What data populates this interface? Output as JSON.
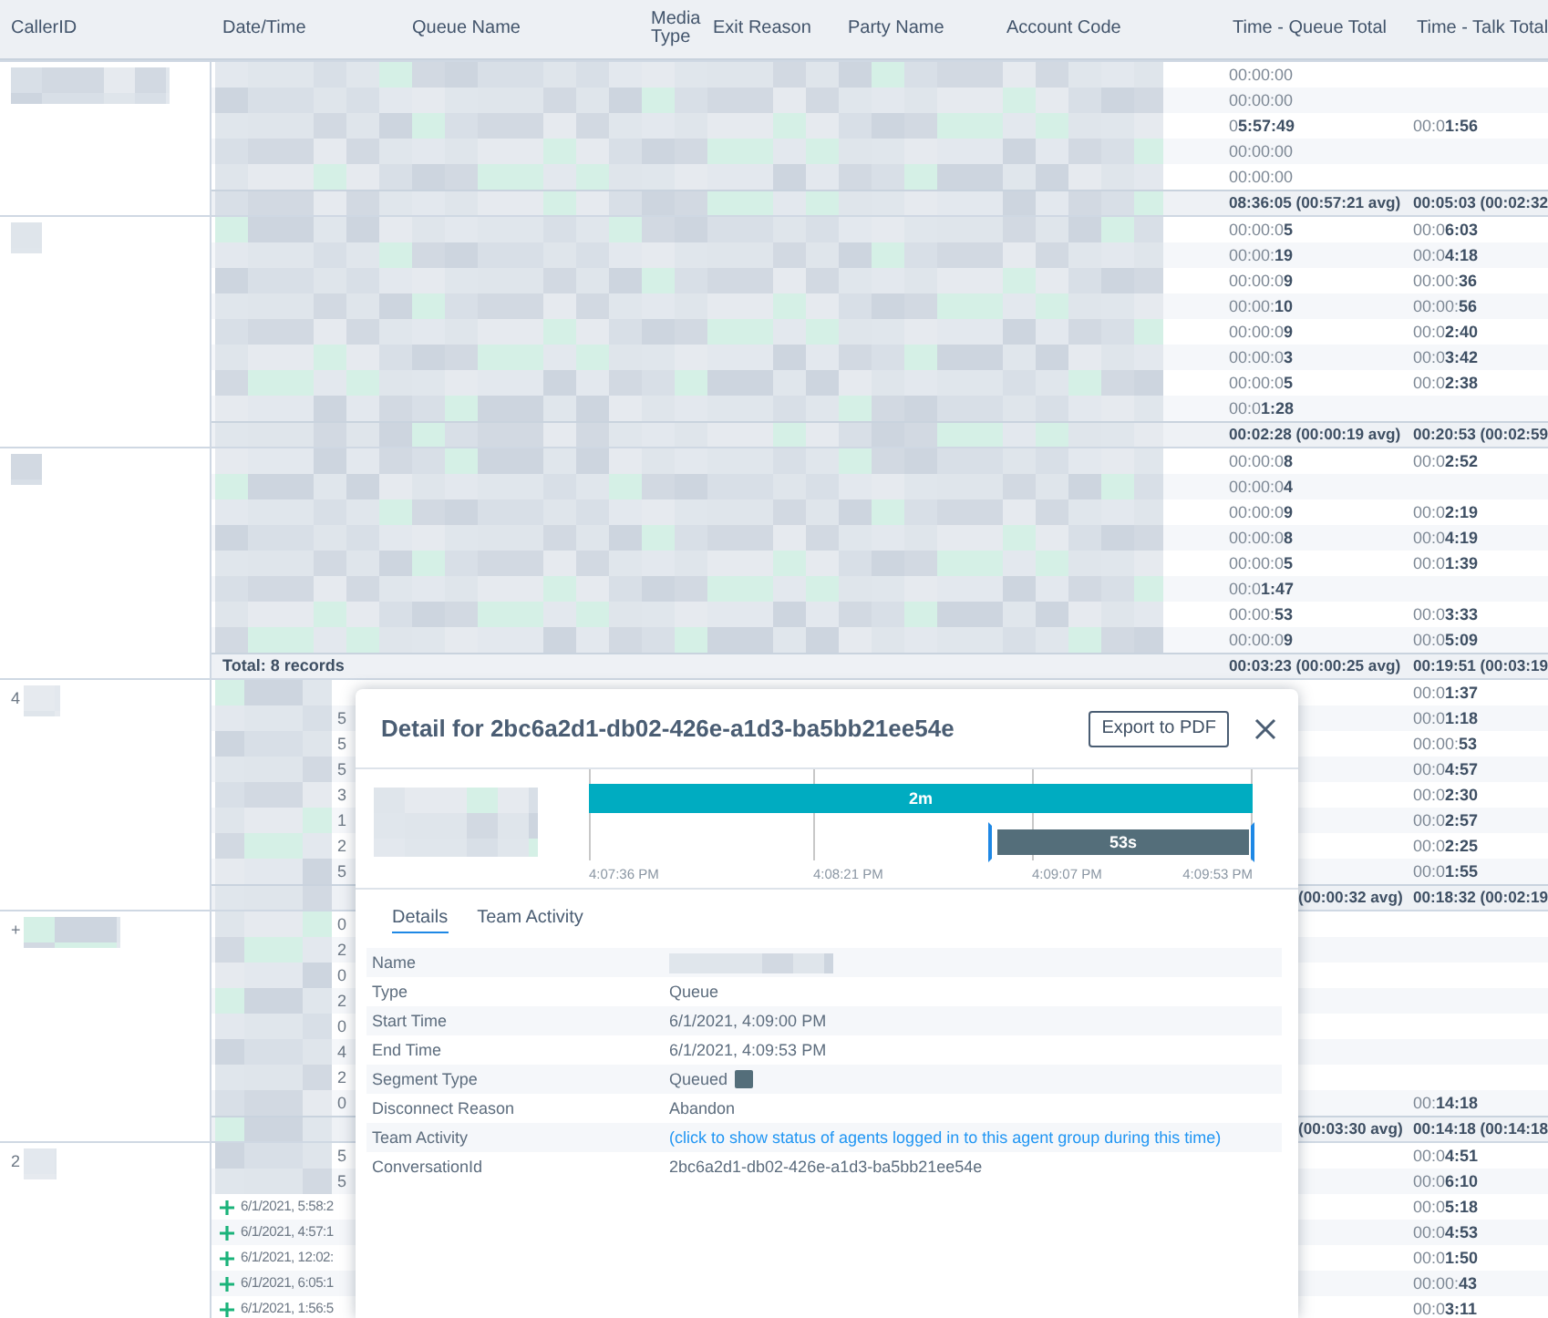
{
  "table": {
    "columns": [
      "CallerID",
      "Date/Time",
      "Queue Name",
      "Media Type",
      "Exit Reason",
      "Party Name",
      "Account Code",
      "Time - Queue Total",
      "Time - Talk Total"
    ],
    "groups": [
      {
        "rows": [
          {
            "kind": "redacted",
            "queue_total": "00:00:00"
          },
          {
            "kind": "redacted",
            "queue_total": "00:00:00"
          },
          {
            "kind": "redacted",
            "queue_total": "0**5:57:49**",
            "talk_total": "00:0**1:56**"
          },
          {
            "kind": "redacted",
            "queue_total": "00:00:00"
          },
          {
            "kind": "redacted",
            "queue_total": "00:00:00"
          }
        ],
        "subtotal": {
          "kind": "redacted",
          "queue_total": "08:36:05 (00:57:21 avg)",
          "talk_total": "00:05:03 (00:02:32"
        }
      },
      {
        "rows": [
          {
            "kind": "redacted",
            "queue_total": "00:00:0**5**",
            "talk_total": "00:0**6:03**"
          },
          {
            "kind": "redacted",
            "queue_total": "00:00:**19**",
            "talk_total": "00:0**4:18**"
          },
          {
            "kind": "redacted",
            "queue_total": "00:00:0**9**",
            "talk_total": "00:00:**36**"
          },
          {
            "kind": "redacted",
            "queue_total": "00:00:**10**",
            "talk_total": "00:00:**56**"
          },
          {
            "kind": "redacted",
            "queue_total": "00:00:0**9**",
            "talk_total": "00:0**2:40**"
          },
          {
            "kind": "redacted",
            "queue_total": "00:00:0**3**",
            "talk_total": "00:0**3:42**"
          },
          {
            "kind": "redacted",
            "queue_total": "00:00:0**5**",
            "talk_total": "00:0**2:38**"
          },
          {
            "kind": "redacted",
            "queue_total": "00:0**1:28**"
          }
        ],
        "subtotal": {
          "kind": "redacted",
          "queue_total": "00:02:28 (00:00:19 avg)",
          "talk_total": "00:20:53 (00:02:59"
        }
      },
      {
        "rows": [
          {
            "kind": "redacted",
            "queue_total": "00:00:0**8**",
            "talk_total": "00:0**2:52**"
          },
          {
            "kind": "redacted",
            "queue_total": "00:00:0**4**"
          },
          {
            "kind": "redacted",
            "queue_total": "00:00:0**9**",
            "talk_total": "00:0**2:19**"
          },
          {
            "kind": "redacted",
            "queue_total": "00:00:0**8**",
            "talk_total": "00:0**4:19**"
          },
          {
            "kind": "redacted",
            "queue_total": "00:00:0**5**",
            "talk_total": "00:0**1:39**"
          },
          {
            "kind": "redacted",
            "queue_total": "00:0**1:47**"
          },
          {
            "kind": "redacted",
            "queue_total": "00:00:**53**",
            "talk_total": "00:0**3:33**"
          },
          {
            "kind": "redacted",
            "queue_total": "00:00:0**9**",
            "talk_total": "00:0**5:09**"
          }
        ],
        "subtotal": {
          "kind": "label",
          "label": "Total: 8 records",
          "queue_total": "00:03:23 (00:00:25 avg)",
          "talk_total": "00:19:51 (00:03:19"
        }
      },
      {
        "caller_id": "4",
        "rows": [
          {
            "kind": "fragment",
            "talk_total": "00:0**1:37**"
          },
          {
            "kind": "fragment",
            "date": "5",
            "talk_total": "00:0**1:18**"
          },
          {
            "kind": "fragment",
            "date": "5",
            "talk_total": "00:00:**53**"
          },
          {
            "kind": "fragment",
            "date": "5",
            "talk_total": "00:0**4:57**"
          },
          {
            "kind": "fragment",
            "date": "3",
            "talk_total": "00:0**2:30**"
          },
          {
            "kind": "fragment",
            "date": "1",
            "talk_total": "00:0**2:57**"
          },
          {
            "kind": "fragment",
            "date": "2",
            "talk_total": "00:0**2:25**"
          },
          {
            "kind": "fragment",
            "date": "5",
            "talk_total": "00:0**1:55**"
          }
        ],
        "subtotal": {
          "kind": "fragment",
          "queue_total": "(00:00:32 avg)",
          "talk_total": "00:18:32 (00:02:19"
        }
      },
      {
        "caller_id": "+",
        "rows": [
          {
            "kind": "fragment",
            "date": "0"
          },
          {
            "kind": "fragment",
            "date": "2"
          },
          {
            "kind": "fragment",
            "date": "0"
          },
          {
            "kind": "fragment",
            "date": "2"
          },
          {
            "kind": "fragment",
            "date": "0"
          },
          {
            "kind": "fragment",
            "date": "4"
          },
          {
            "kind": "fragment",
            "date": "2"
          },
          {
            "kind": "fragment",
            "date": "0",
            "talk_total": "00:**14:18**"
          }
        ],
        "subtotal": {
          "kind": "fragment",
          "queue_total": "(00:03:30 avg)",
          "talk_total": "00:14:18 (00:14:18"
        }
      },
      {
        "caller_id": "2",
        "rows": [
          {
            "kind": "fragment",
            "date": "5",
            "talk_total": "00:0**4:51**"
          },
          {
            "kind": "fragment",
            "date": "5",
            "talk_total": "00:0**6:10**"
          },
          {
            "kind": "expandable",
            "date": "6/1/2021, 5:58:2",
            "talk_total": "00:0**5:18**"
          },
          {
            "kind": "expandable",
            "date": "6/1/2021, 4:57:1",
            "talk_total": "00:0**4:53**"
          },
          {
            "kind": "expandable",
            "date": "6/1/2021, 12:02:",
            "talk_total": "00:0**1:50**"
          },
          {
            "kind": "expandable",
            "date": "6/1/2021, 6:05:1",
            "talk_total": "00:00:**43**"
          },
          {
            "kind": "expandable",
            "date": "6/1/2021, 1:56:5",
            "talk_total": "00:0**3:11**"
          }
        ]
      }
    ]
  },
  "dialog": {
    "title": "Detail for 2bc6a2d1-db02-426e-a1d3-ba5bb21ee54e",
    "export_button": "Export to PDF",
    "timeline": {
      "bars": [
        {
          "kind": "full",
          "label": "2m",
          "selected": false
        },
        {
          "kind": "tail",
          "label": "53s",
          "selected": true
        }
      ],
      "ticks": [
        "4:07:36 PM",
        "4:08:21 PM",
        "4:09:07 PM",
        "4:09:53 PM"
      ]
    },
    "tabs": [
      {
        "label": "Details",
        "selected": true
      },
      {
        "label": "Team Activity",
        "selected": false
      }
    ],
    "details": [
      {
        "label": "Name",
        "kind": "redacted"
      },
      {
        "label": "Type",
        "kind": "text",
        "value": "Queue"
      },
      {
        "label": "Start Time",
        "kind": "text",
        "value": "6/1/2021, 4:09:00 PM"
      },
      {
        "label": "End Time",
        "kind": "text",
        "value": "6/1/2021, 4:09:53 PM"
      },
      {
        "label": "Segment Type",
        "kind": "swatch",
        "value": "Queued"
      },
      {
        "label": "Disconnect Reason",
        "kind": "text",
        "value": "Abandon"
      },
      {
        "label": "Team Activity",
        "kind": "link",
        "value": "(click to show status of agents logged in to this agent group during this time)"
      },
      {
        "label": "ConversationId",
        "kind": "text",
        "value": "2bc6a2d1-db02-426e-a1d3-ba5bb21ee54e"
      }
    ]
  }
}
